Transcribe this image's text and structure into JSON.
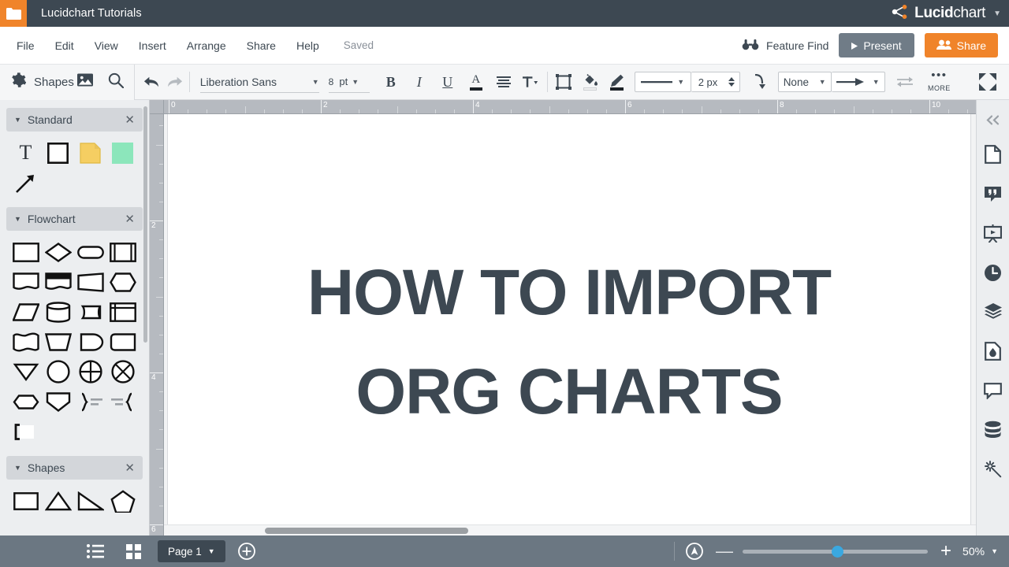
{
  "titlebar": {
    "folder_icon": "folder-icon",
    "document_title": "Lucidchart Tutorials",
    "brand_bold": "Lucid",
    "brand_light": "chart",
    "brand_caret": "▼"
  },
  "menubar": {
    "items": [
      {
        "label": "File"
      },
      {
        "label": "Edit"
      },
      {
        "label": "View"
      },
      {
        "label": "Insert"
      },
      {
        "label": "Arrange"
      },
      {
        "label": "Share"
      },
      {
        "label": "Help"
      }
    ],
    "save_status": "Saved",
    "feature_find": "Feature Find",
    "present_label": "Present",
    "share_label": "Share"
  },
  "toolbar": {
    "shapes_label": "Shapes",
    "font_name": "Liberation Sans",
    "font_size": "8",
    "font_size_unit": "pt",
    "bold": "B",
    "italic": "I",
    "underline": "U",
    "line_width": "2 px",
    "arrow_start": "None",
    "more_label": "MORE",
    "caret": "▼"
  },
  "left_panel": {
    "sections": [
      {
        "name": "Standard",
        "shapes": [
          "text-shape",
          "rectangle-shape",
          "note-shape",
          "sticky-shape",
          "arrow-line-shape"
        ]
      },
      {
        "name": "Flowchart",
        "shapes": [
          "process-shape",
          "decision-shape",
          "terminator-shape",
          "predefined-process-shape",
          "document-shape",
          "multi-document-shape",
          "data-shape",
          "preparation-shape",
          "parallelogram-shape",
          "direct-data-shape",
          "stored-data-shape",
          "internal-storage-shape",
          "paper-tape-shape",
          "manual-operation-shape",
          "display-shape",
          "delay-shape",
          "extract-shape",
          "circle-shape",
          "summing-junction-shape",
          "or-shape",
          "hexagon-shape",
          "manual-input-shape",
          "brace-right-shape",
          "brace-left-shape",
          "annotation-shape"
        ]
      },
      {
        "name": "Shapes",
        "shapes": [
          "rectangle-shape",
          "triangle-shape",
          "right-triangle-shape",
          "pentagon-shape"
        ]
      }
    ],
    "close_glyph": "✕",
    "collapse_glyph": "▼"
  },
  "rulers": {
    "horizontal_labels": [
      "0",
      "2",
      "4",
      "6",
      "8",
      "10"
    ],
    "vertical_labels": [
      "2",
      "4",
      "6"
    ],
    "unit": "in"
  },
  "canvas": {
    "title_line1": "HOW TO IMPORT",
    "title_line2": "ORG CHARTS",
    "title_color": "#3d4852"
  },
  "right_rail": {
    "items": [
      {
        "icon": "collapse-chevrons-icon"
      },
      {
        "icon": "document-page-icon"
      },
      {
        "icon": "quote-comment-icon"
      },
      {
        "icon": "presentation-icon"
      },
      {
        "icon": "clock-history-icon"
      },
      {
        "icon": "layers-icon"
      },
      {
        "icon": "theme-droplet-icon"
      },
      {
        "icon": "comment-bubble-icon"
      },
      {
        "icon": "database-icon"
      },
      {
        "icon": "magic-wand-icon"
      }
    ]
  },
  "bottombar": {
    "list_view_icon": "list-view-icon",
    "grid_view_icon": "grid-view-icon",
    "page_label": "Page 1",
    "page_caret": "▼",
    "add_page_icon": "add-page-icon",
    "fit_icon": "fit-to-screen-icon",
    "zoom_minus": "—",
    "zoom_plus": "+",
    "zoom_level": "50%",
    "zoom_caret": "▼"
  },
  "colors": {
    "brand_orange": "#f0842a",
    "dark_slate": "#3d4852",
    "bottom_bar": "#6b7782",
    "slider_blue": "#3aa8e0"
  }
}
